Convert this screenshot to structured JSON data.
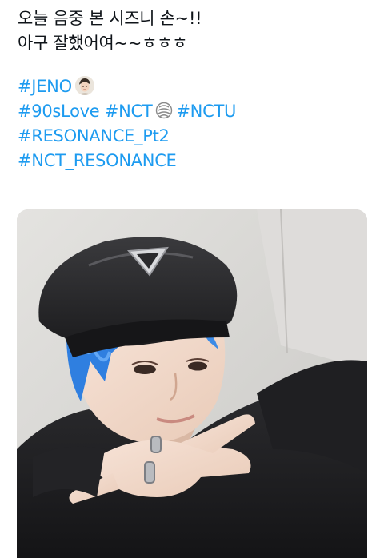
{
  "tweet": {
    "line1": "오늘 음중 본 시즈니 손~!!",
    "line2": "아구 잘했어여~~ㅎㅎㅎ",
    "hashtags": {
      "jeno": "#JENO",
      "love90s": "#90sLove",
      "nct": "#NCT",
      "nctu": "#NCTU",
      "resonance_pt2": "#RESONANCE_Pt2",
      "nct_resonance": "#NCT_RESONANCE"
    },
    "emojis": [
      "jeno-face-emoji",
      "nct-logo-emoji"
    ],
    "colors": {
      "hashtag": "#1d9bf0",
      "text": "#0f1419"
    }
  }
}
